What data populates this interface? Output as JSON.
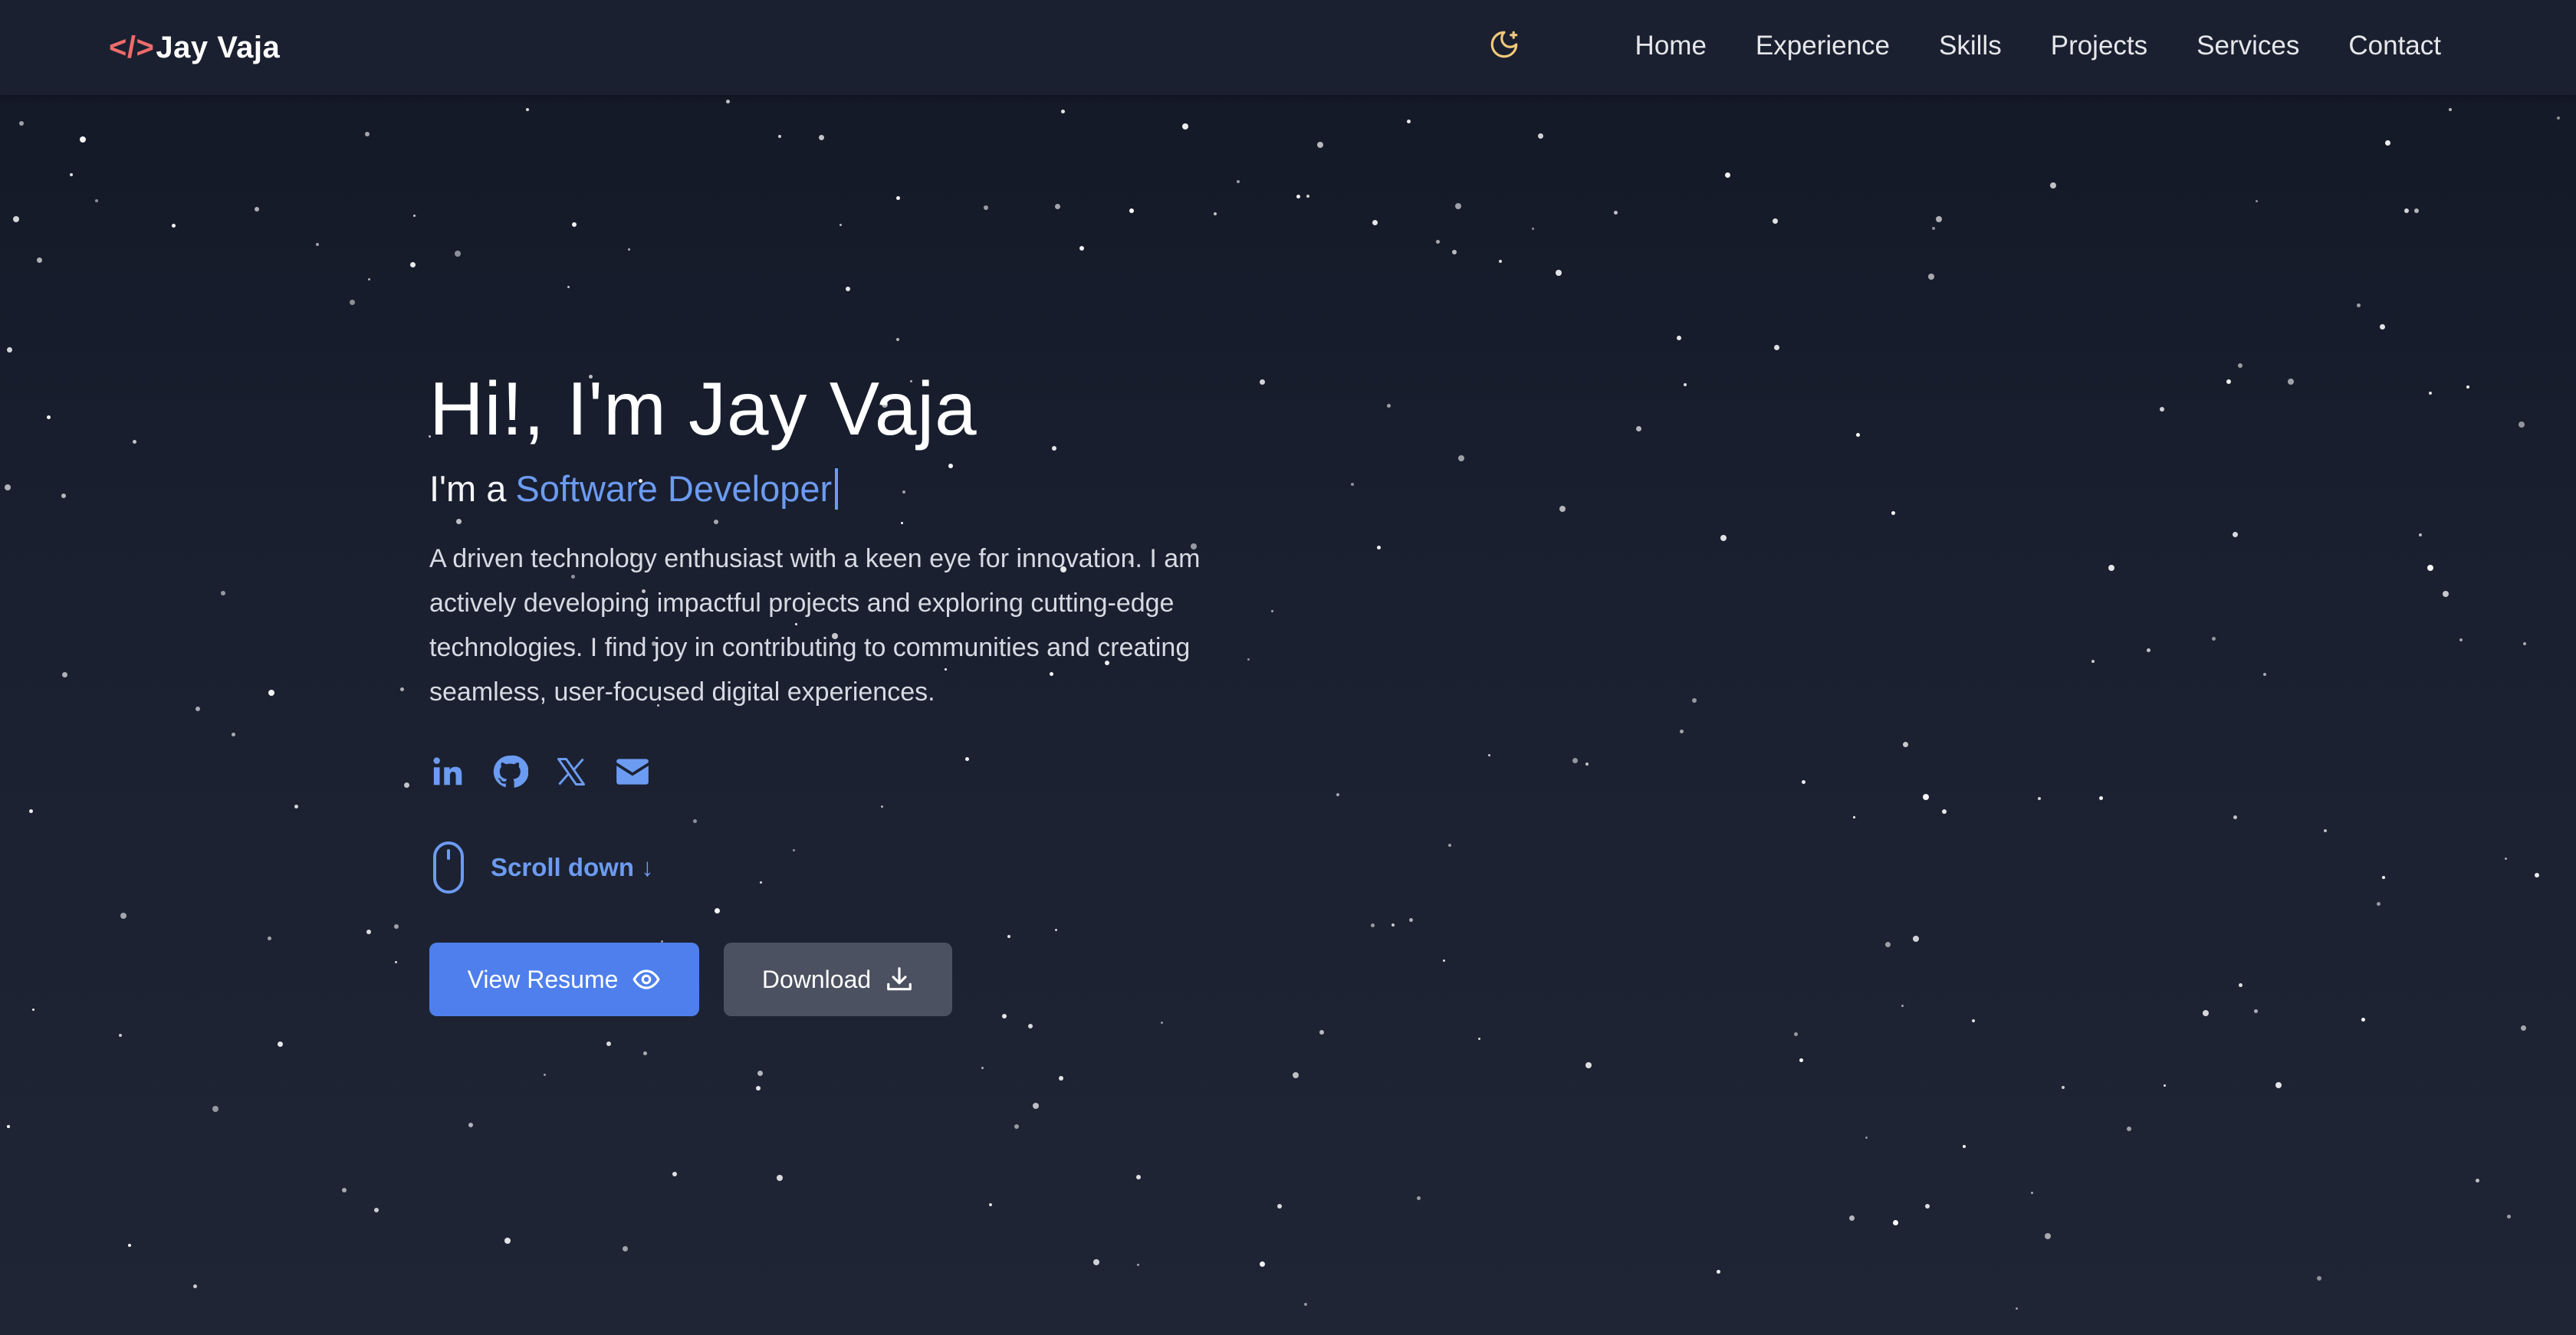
{
  "navbar": {
    "logo_code": "</>",
    "logo_name": "Jay Vaja",
    "theme_toggle_icon": "moon-star-icon",
    "links": [
      "Home",
      "Experience",
      "Skills",
      "Projects",
      "Services",
      "Contact"
    ]
  },
  "hero": {
    "greeting": "Hi!, I'm Jay Vaja",
    "tagline_prefix": "I'm a",
    "tagline_role": "Software Developer",
    "bio": "A driven technology enthusiast with a keen eye for innovation. I am actively developing impactful projects and exploring cutting-edge technologies. I find joy in contributing to communities and creating seamless, user-focused digital experiences.",
    "socials": [
      "linkedin-icon",
      "github-icon",
      "x-icon",
      "mail-icon"
    ],
    "scroll_label": "Scroll down ↓",
    "view_resume_label": "View Resume",
    "download_label": "Download"
  },
  "colors": {
    "accent": "#4f7fec",
    "role_text": "#6c9bf2",
    "logo_code": "#ef6b6b",
    "moon": "#f2c97a",
    "secondary_button": "#4b5160"
  }
}
